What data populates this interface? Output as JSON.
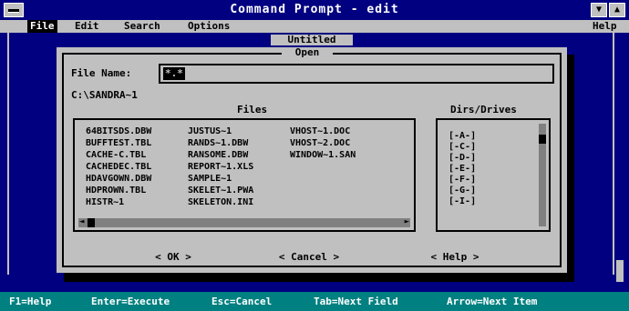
{
  "window": {
    "title": "Command Prompt - edit",
    "minimize_glyph": "▼",
    "maximize_glyph": "▲"
  },
  "menubar": {
    "file": "File",
    "edit": "Edit",
    "search": "Search",
    "options": "Options",
    "help": "Help"
  },
  "document": {
    "title": "Untitled"
  },
  "dialog": {
    "title": "Open",
    "filename_label": "File Name:",
    "filename_value": "*.*",
    "current_path": "C:\\SANDRA~1",
    "files_label": "Files",
    "dirs_label": "Dirs/Drives",
    "files": [
      "64BITSDS.DBW",
      "BUFFTEST.TBL",
      "CACHE-C.TBL",
      "CACHEDEC.TBL",
      "HDAVGOWN.DBW",
      "HDPROWN.TBL",
      "HISTR~1",
      "JUSTUS~1",
      "RANDS~1.DBW",
      "RANSOME.DBW",
      "REPORT~1.XLS",
      "SAMPLE~1",
      "SKELET~1.PWA",
      "SKELETON.INI",
      "VHOST~1.DOC",
      "VHOST~2.DOC",
      "WINDOW~1.SAN"
    ],
    "drives": [
      "[-A-]",
      "[-C-]",
      "[-D-]",
      "[-E-]",
      "[-F-]",
      "[-G-]",
      "[-I-]"
    ],
    "ok_label": "< OK >",
    "cancel_label": "< Cancel >",
    "help_label": "< Help >"
  },
  "statusbar": {
    "f1": "F1=Help",
    "enter": "Enter=Execute",
    "esc": "Esc=Cancel",
    "tab": "Tab=Next Field",
    "arrow": "Arrow=Next Item"
  }
}
